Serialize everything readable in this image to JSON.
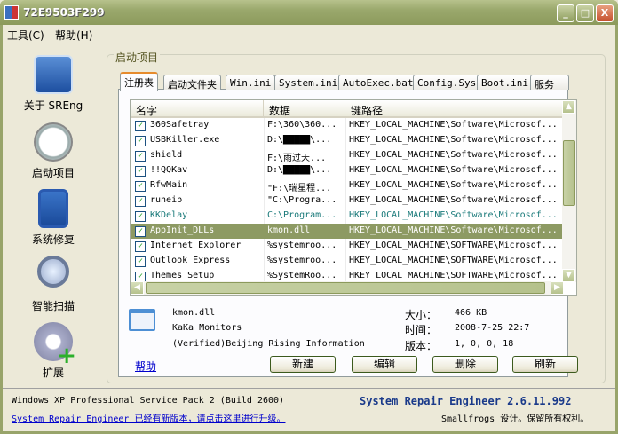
{
  "window": {
    "title": "72E9503F299",
    "minimize": "_",
    "maximize": "□",
    "close": "X"
  },
  "menu": [
    "工具(C)",
    "帮助(H)"
  ],
  "sidebar": [
    {
      "label": "关于 SREng",
      "icon": "tools-icon"
    },
    {
      "label": "启动项目",
      "icon": "clock-icon"
    },
    {
      "label": "系统修复",
      "icon": "checklist-icon"
    },
    {
      "label": "智能扫描",
      "icon": "magnifier-icon"
    },
    {
      "label": "扩展",
      "icon": "gear-plus-icon"
    }
  ],
  "group_title": "启动项目",
  "tabs": [
    "注册表",
    "启动文件夹",
    "Win.ini",
    "System.ini",
    "AutoExec.bat",
    "Config.Sys",
    "Boot.ini",
    "服务"
  ],
  "active_tab": "注册表",
  "columns": [
    "名字",
    "数据",
    "键路径"
  ],
  "rows": [
    {
      "name": "360Safetray",
      "data": "F:\\360\\360...",
      "path": "HKEY_LOCAL_MACHINE\\Software\\Microsof...",
      "checked": true
    },
    {
      "name": "USBKiller.exe",
      "data": "D:\\█████\\...",
      "path": "HKEY_LOCAL_MACHINE\\Software\\Microsof...",
      "checked": true
    },
    {
      "name": "shield",
      "data": "F:\\雨过天...",
      "path": "HKEY_LOCAL_MACHINE\\Software\\Microsof...",
      "checked": true
    },
    {
      "name": "!!QQKav",
      "data": "D:\\█████\\...",
      "path": "HKEY_LOCAL_MACHINE\\Software\\Microsof...",
      "checked": true
    },
    {
      "name": "RfwMain",
      "data": "\"F:\\瑞星程...",
      "path": "HKEY_LOCAL_MACHINE\\Software\\Microsof...",
      "checked": true
    },
    {
      "name": "runeip",
      "data": "\"C:\\Progra...",
      "path": "HKEY_LOCAL_MACHINE\\Software\\Microsof...",
      "checked": true
    },
    {
      "name": "KKDelay",
      "data": "C:\\Program...",
      "path": "HKEY_LOCAL_MACHINE\\Software\\Microsof...",
      "checked": true,
      "highlight": true
    },
    {
      "name": "AppInit_DLLs",
      "data": "kmon.dll",
      "path": "HKEY_LOCAL_MACHINE\\Software\\Microsof...",
      "checked": true,
      "selected": true
    },
    {
      "name": "Internet Explorer",
      "data": "%systemroo...",
      "path": "HKEY_LOCAL_MACHINE\\SOFTWARE\\Microsof...",
      "checked": true
    },
    {
      "name": "Outlook Express",
      "data": "%systemroo...",
      "path": "HKEY_LOCAL_MACHINE\\SOFTWARE\\Microsof...",
      "checked": true
    },
    {
      "name": "Themes Setup",
      "data": "%SystemRoo...",
      "path": "HKEY_LOCAL_MACHINE\\SOFTWARE\\Microsof...",
      "checked": true
    }
  ],
  "details": {
    "file": "kmon.dll",
    "product": "KaKa Monitors",
    "company": "(Verified)Beijing Rising Information",
    "size_label": "大小：",
    "size": "466 KB",
    "time_label": "时间：",
    "time": "2008-7-25 22:7",
    "version_label": "版本：",
    "version": "1, 0, 0, 18"
  },
  "help_link": "帮助",
  "buttons": [
    "新建",
    "编辑",
    "删除",
    "刷新"
  ],
  "status": {
    "os": "Windows XP Professional Service Pack 2 (Build 2600)",
    "update_link": "System Repair Engineer 已经有新版本，请点击这里进行升级。",
    "product": "System Repair Engineer 2.6.11.992",
    "credit": "Smallfrogs 设计。保留所有权利。"
  },
  "colors": {
    "titlebar": "#9aa86c",
    "selected_row": "#8d9a63",
    "highlight_text": "#1a7a7a",
    "product_text": "#1a3a8a"
  }
}
